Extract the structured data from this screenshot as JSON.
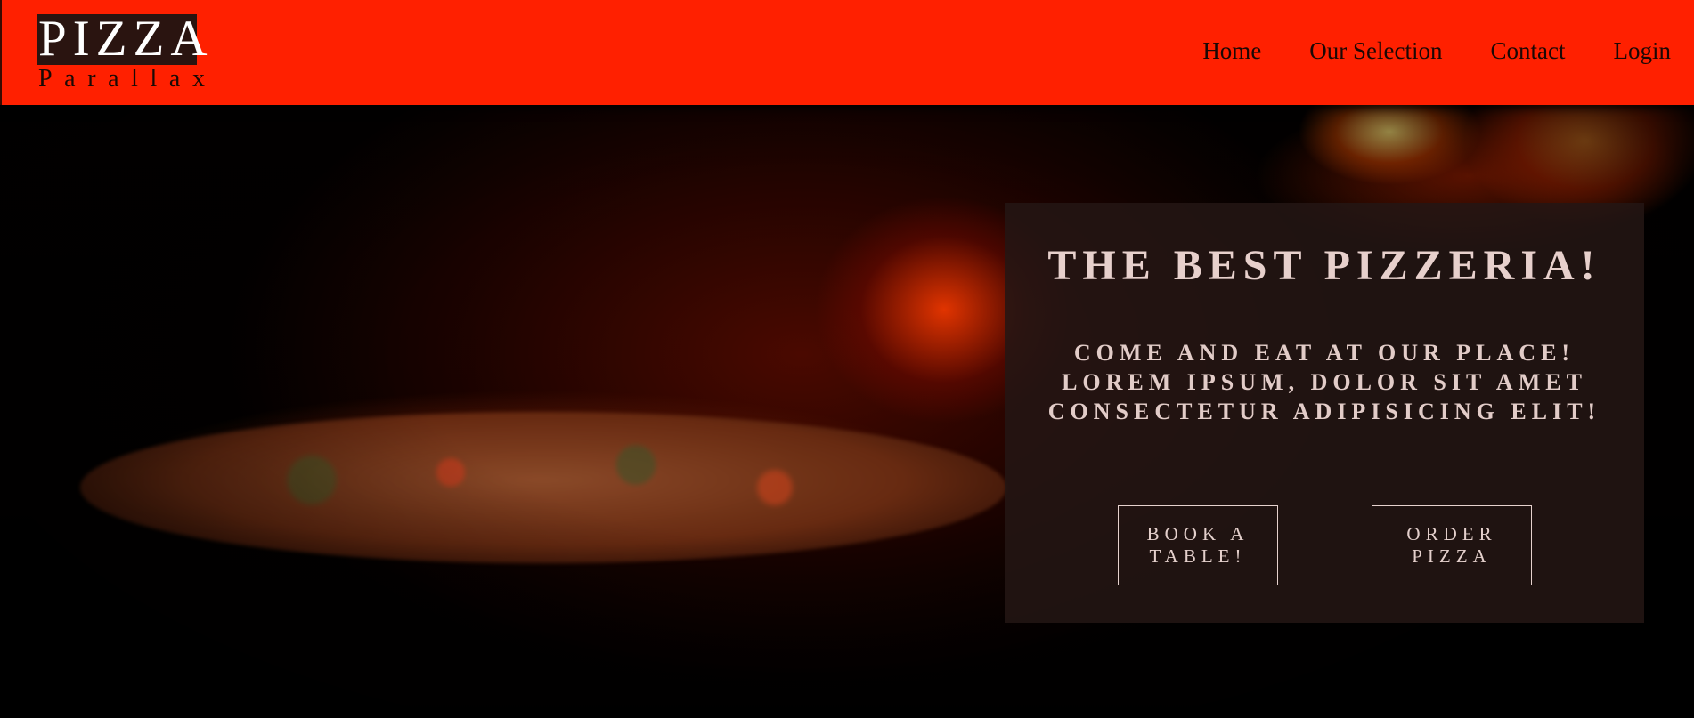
{
  "header": {
    "logo_main": "PIZZA",
    "logo_sub": "Parallax",
    "nav": [
      {
        "label": "Home"
      },
      {
        "label": "Our Selection"
      },
      {
        "label": "Contact"
      },
      {
        "label": "Login"
      }
    ]
  },
  "hero": {
    "title": "THE BEST PIZZERIA!",
    "subtitle": "COME AND EAT AT OUR PLACE! LOREM IPSUM, DOLOR SIT AMET CONSECTETUR ADIPISICING ELIT!",
    "buttons": {
      "book": "BOOK A TABLE!",
      "order": "ORDER PIZZA"
    }
  },
  "colors": {
    "header_bg": "#ff2000",
    "logo_bg": "#2a1410",
    "overlay_bg": "#241614",
    "overlay_text": "#e7d0cc"
  }
}
